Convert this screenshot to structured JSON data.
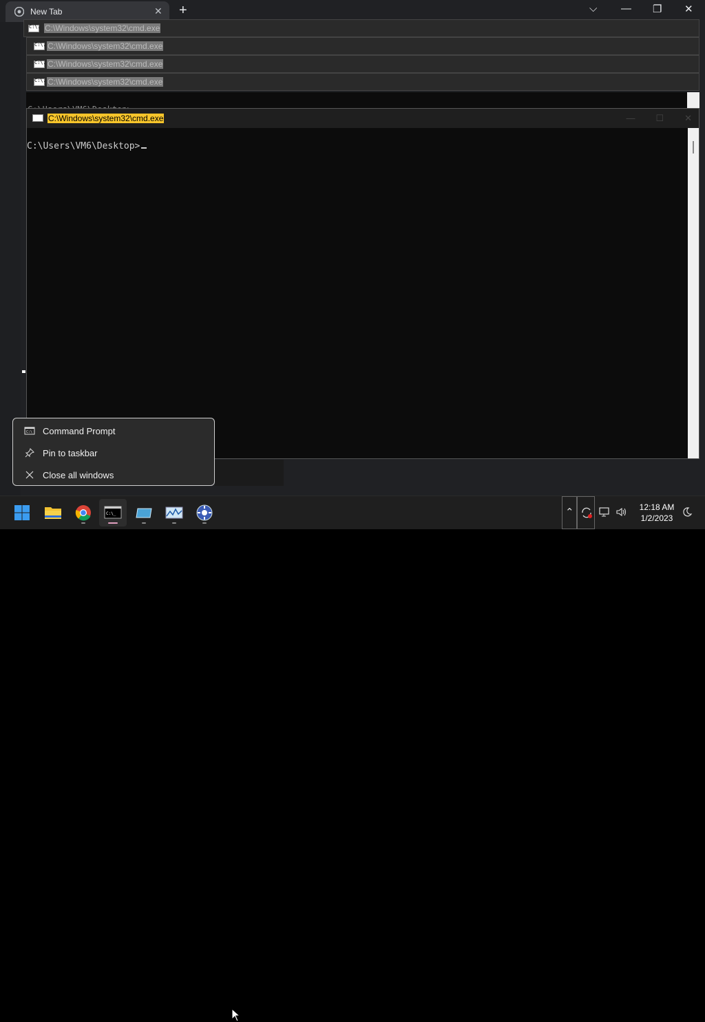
{
  "chrome": {
    "tab_title": "New Tab",
    "tab_close": "✕",
    "new_tab": "+",
    "dropdown": "⌵",
    "minimize": "—",
    "restore": "❐",
    "close": "✕"
  },
  "stacked_windows": [
    {
      "title": "C:\\Windows\\system32\\cmd.exe"
    },
    {
      "title": "C:\\Windows\\system32\\cmd.exe"
    },
    {
      "title": "C:\\Windows\\system32\\cmd.exe"
    },
    {
      "title": "C:\\Windows\\system32\\cmd.exe"
    }
  ],
  "behind_text": "C:\\Users\\VM6\\Desktop>",
  "main_window": {
    "title": "C:\\Windows\\system32\\cmd.exe",
    "prompt": "C:\\Users\\VM6\\Desktop>"
  },
  "context_menu": {
    "items": [
      {
        "label": "Command Prompt",
        "icon": "cmd-icon"
      },
      {
        "label": "Pin to taskbar",
        "icon": "pin-icon"
      },
      {
        "label": "Close all windows",
        "icon": "close-icon"
      }
    ]
  },
  "taskbar": {
    "apps": [
      "start",
      "file-explorer",
      "chrome",
      "command-prompt",
      "app-blue",
      "resource-monitor",
      "app-settings"
    ],
    "time": "12:18 AM",
    "date": "1/2/2023"
  }
}
